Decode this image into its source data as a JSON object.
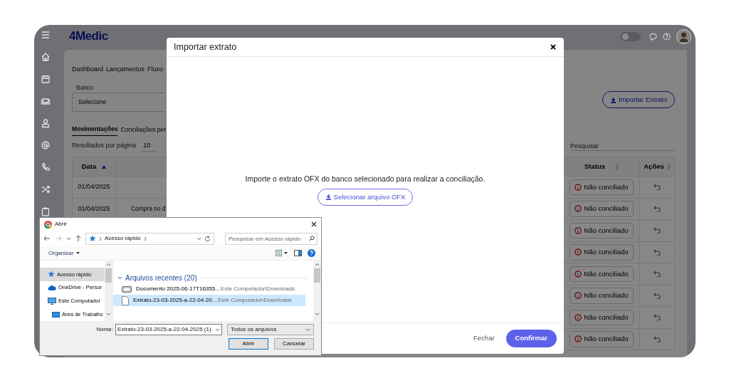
{
  "app": {
    "logo": "4Medic",
    "theme_toggle": {
      "on": false
    },
    "nav_links": [
      {
        "label": "Dashboard"
      },
      {
        "label": "Lançamentos"
      },
      {
        "label": "Fluxo"
      }
    ],
    "bank_field": {
      "label": "Banco",
      "value": "Selecione"
    },
    "import_button": "Importar Extrato",
    "tabs": [
      {
        "label": "Movimentações",
        "selected": true
      },
      {
        "label": "Conciliações per",
        "selected": false
      }
    ],
    "page_size": {
      "label": "Resultados por página",
      "value": "10"
    },
    "search": {
      "placeholder": "Pesquisar"
    },
    "table": {
      "columns": [
        "Data",
        "Status",
        "Ações"
      ],
      "rows": [
        {
          "date": "01/04/2025",
          "status": "Não conciliado"
        },
        {
          "date": "01/04/2025",
          "description": "Compra no d",
          "status": "Não conciliado"
        },
        {
          "status": "Não conciliado"
        },
        {
          "status": "Não conciliado"
        },
        {
          "status": "Não conciliado"
        },
        {
          "status": "Não conciliado"
        },
        {
          "status": "Não conciliado"
        },
        {
          "status": "Não conciliado"
        }
      ]
    }
  },
  "modal": {
    "title": "Importar extrato",
    "message": "Importe o extrato OFX do banco selecionado para realizar a conciliação.",
    "select_button": "Selecionar arquivo OFX",
    "close_button": "Fechar",
    "confirm_button": "Confirmar"
  },
  "file_dialog": {
    "title": "Abrir",
    "path": "Acesso rápido",
    "search": {
      "placeholder": "Pesquisar em Acesso rápido"
    },
    "organize": "Organizar",
    "nav_items": [
      {
        "label": "Acesso rápido",
        "kind": "star",
        "selected": true
      },
      {
        "label": "OneDrive - Persor",
        "kind": "cloud",
        "selected": false
      },
      {
        "label": "Este Computador",
        "kind": "computer",
        "selected": false,
        "children": [
          {
            "label": "Área de Trabalhc",
            "kind": "desktop",
            "selected": false
          }
        ]
      }
    ],
    "section": "Arquivos recentes (20)",
    "files": [
      {
        "name": "Documento 2025-06-17T16355...",
        "location": "Este Computador\\Downloads",
        "kind": "drive",
        "selected": false
      },
      {
        "name": "Extrato-23-03-2025-a-22-04-20...",
        "location": "Este Computador\\Downloads",
        "kind": "page",
        "selected": true
      }
    ],
    "filename_label": "Nome:",
    "filename": "Extrato-23-03-2025-a-22-04-2025 (1).",
    "file_type": "Todos os arquivos",
    "open_button": "Abrir",
    "cancel_button": "Cancelar"
  }
}
